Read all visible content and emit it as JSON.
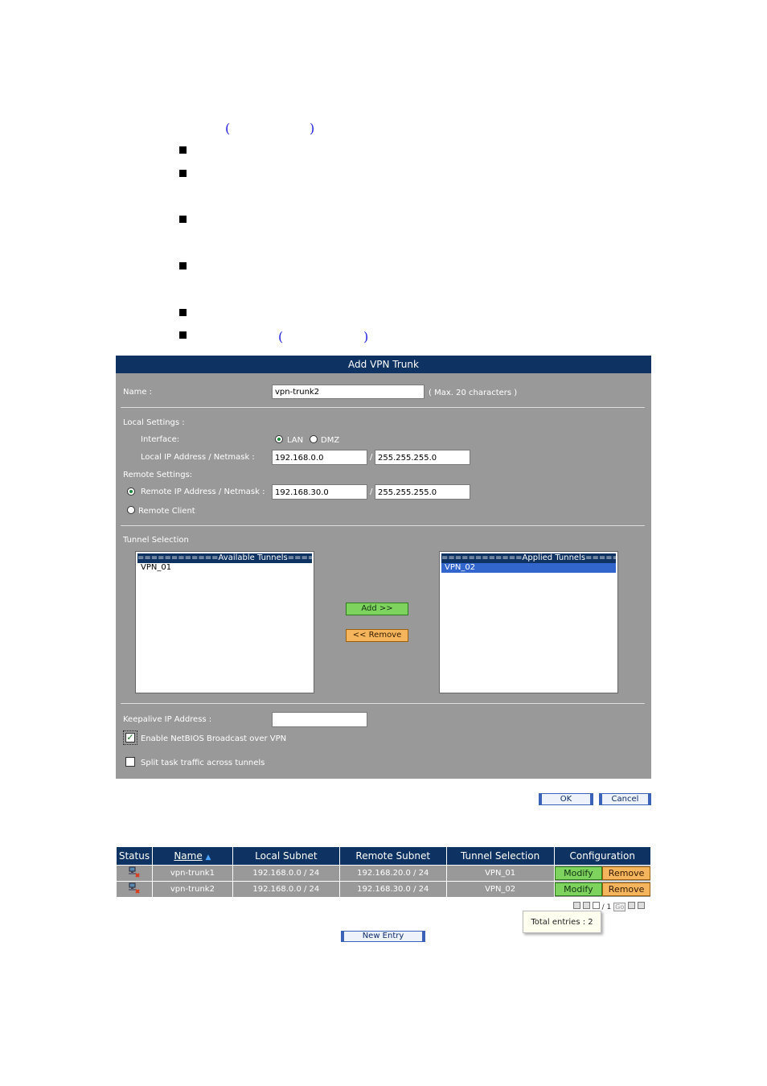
{
  "panel": {
    "title": "Add VPN Trunk",
    "name_label": "Name :",
    "name_value": "vpn-trunk2",
    "name_hint": "( Max. 20 characters )",
    "local_settings_label": "Local Settings :",
    "interface_label": "Interface:",
    "interface_options": [
      "LAN",
      "DMZ"
    ],
    "interface_selected": "LAN",
    "local_ip_label": "Local IP Address / Netmask :",
    "local_ip": "192.168.0.0",
    "local_mask": "255.255.255.0",
    "remote_settings_label": "Remote Settings:",
    "remote_ip_label": "Remote IP Address / Netmask :",
    "remote_ip": "192.168.30.0",
    "remote_mask": "255.255.255.0",
    "remote_client_label": "Remote Client",
    "slash": "/",
    "tunnel_selection_label": "Tunnel Selection",
    "available_header": "============Available Tunnels============",
    "available_items": [
      "VPN_01"
    ],
    "applied_header": "============Applied Tunnels============",
    "applied_items": [
      "VPN_02"
    ],
    "add_button": "Add >>",
    "remove_button": "<< Remove",
    "keepalive_label": "Keepalive IP Address :",
    "keepalive_value": "",
    "netbios_label": "Enable NetBIOS Broadcast over VPN",
    "netbios_checked": true,
    "split_label": "Split task traffic across tunnels",
    "split_checked": false
  },
  "buttons": {
    "ok": "OK",
    "cancel": "Cancel",
    "new_entry": "New Entry"
  },
  "table": {
    "headers": [
      "Status",
      "Name",
      "Local Subnet",
      "Remote Subnet",
      "Tunnel Selection",
      "Configuration"
    ],
    "rows": [
      {
        "name": "vpn-trunk1",
        "local": "192.168.0.0 / 24",
        "remote": "192.168.20.0 / 24",
        "tunnel": "VPN_01",
        "modify": "Modify",
        "remove": "Remove"
      },
      {
        "name": "vpn-trunk2",
        "local": "192.168.0.0 / 24",
        "remote": "192.168.30.0 / 24",
        "tunnel": "VPN_02",
        "modify": "Modify",
        "remove": "Remove"
      }
    ]
  },
  "pager": {
    "current": "1",
    "of": "/ 1",
    "go": "Go"
  },
  "tooltip": {
    "total_entries": "Total entries : 2"
  },
  "colors": {
    "panel_bg": "#999999",
    "header_bg": "#0e3261",
    "selected": "#3266cc"
  }
}
